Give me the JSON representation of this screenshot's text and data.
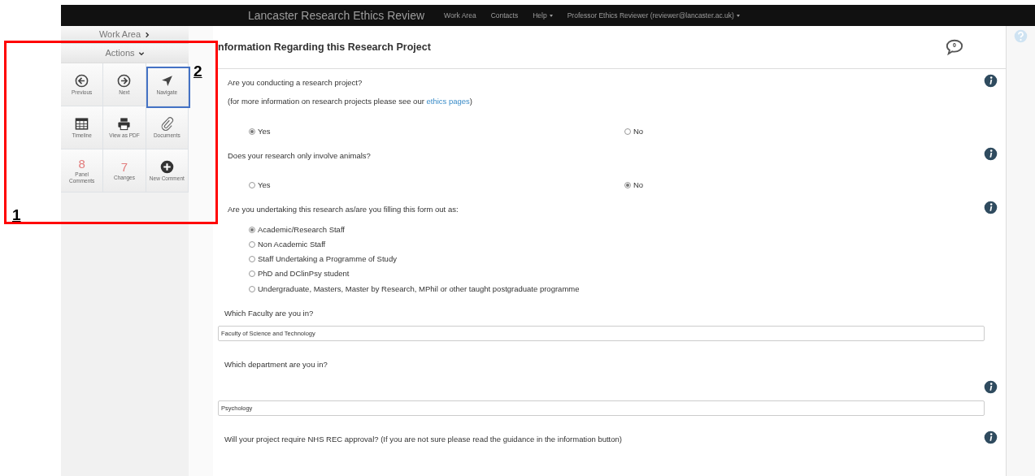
{
  "navbar": {
    "brand": "Lancaster Research Ethics Review",
    "links": [
      {
        "label": "Work Area",
        "dropdown": false
      },
      {
        "label": "Contacts",
        "dropdown": false
      },
      {
        "label": "Help",
        "dropdown": true
      },
      {
        "label": "Professor Ethics Reviewer (reviewer@lancaster.ac.uk)",
        "dropdown": true
      }
    ]
  },
  "sidebar": {
    "work_area": "Work Area",
    "actions_header": "Actions",
    "actions": [
      {
        "kind": "icon",
        "label": "Previous"
      },
      {
        "kind": "icon",
        "label": "Next"
      },
      {
        "kind": "icon",
        "label": "Navigate"
      },
      {
        "kind": "icon",
        "label": "Timeline"
      },
      {
        "kind": "icon",
        "label": "View as PDF"
      },
      {
        "kind": "icon",
        "label": "Documents"
      },
      {
        "kind": "count",
        "count": "8",
        "label": "Panel Comments"
      },
      {
        "kind": "count",
        "count": "7",
        "label": "Changes"
      },
      {
        "kind": "icon",
        "label": "New Comment"
      }
    ]
  },
  "main": {
    "title": "nformation Regarding this Research Project",
    "comment_count": "0",
    "questions": [
      {
        "kind": "radio_inline",
        "text": "Are you conducting a research project?",
        "note": "(for more information on research projects please see our ",
        "note_link": "ethics pages",
        "note_end": ")",
        "info": true,
        "options": [
          {
            "label": "Yes",
            "selected": true
          },
          {
            "label": "No",
            "selected": false
          }
        ]
      },
      {
        "kind": "radio_inline",
        "text": "Does your research only involve animals?",
        "info": true,
        "options": [
          {
            "label": "Yes",
            "selected": false
          },
          {
            "label": "No",
            "selected": true
          }
        ]
      },
      {
        "kind": "radio_stacked",
        "text": "Are you undertaking this research as/are you filling this form out as:",
        "info": true,
        "options": [
          {
            "label": "Academic/Research Staff",
            "selected": true
          },
          {
            "label": "Non Academic Staff",
            "selected": false
          },
          {
            "label": "Staff Undertaking a Programme of Study",
            "selected": false
          },
          {
            "label": "PhD and DClinPsy student",
            "selected": false
          },
          {
            "label": "Undergraduate, Masters, Master by Research, MPhil or other taught postgraduate programme",
            "selected": false
          }
        ]
      },
      {
        "kind": "text",
        "text": "Which Faculty are you in?",
        "value": "Faculty of Science and Technology",
        "info": false
      },
      {
        "kind": "text",
        "text": "Which department are you in?",
        "value": "Psychology",
        "info": true
      },
      {
        "kind": "label",
        "text": "Will your project require NHS REC approval? (If you are not sure please read the guidance in the information button)",
        "info": true
      }
    ]
  },
  "annotations": [
    {
      "label": "1",
      "color": "#ff0000"
    },
    {
      "label": "2",
      "color": "#4472c4"
    }
  ]
}
